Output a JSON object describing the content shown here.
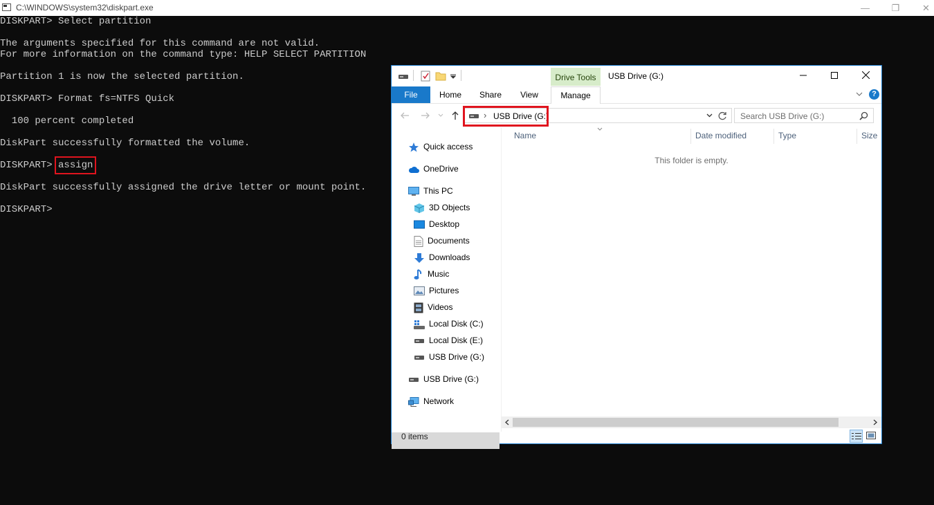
{
  "console": {
    "title": "C:\\WINDOWS\\system32\\diskpart.exe",
    "lines": [
      "DISKPART> Select partition",
      "",
      "The arguments specified for this command are not valid.",
      "For more information on the command type: HELP SELECT PARTITION",
      "",
      "Partition 1 is now the selected partition.",
      "",
      "DISKPART> Format fs=NTFS Quick",
      "",
      "  100 percent completed",
      "",
      "DiskPart successfully formatted the volume.",
      "",
      "",
      "",
      "DiskPart successfully assigned the drive letter or mount point.",
      "",
      "DISKPART>"
    ],
    "assign_prompt": "DISKPART> ",
    "assign_command": "assign",
    "buttons": {
      "minimize": "—",
      "restore": "❐",
      "close": "✕"
    }
  },
  "explorer": {
    "context_tab": "Drive Tools",
    "window_title": "USB Drive (G:)",
    "tabs": {
      "file": "File",
      "home": "Home",
      "share": "Share",
      "view": "View",
      "manage": "Manage"
    },
    "address": {
      "separator": "›",
      "location": "USB Drive (G:)"
    },
    "search_placeholder": "Search USB Drive (G:)",
    "columns": {
      "name": "Name",
      "date_modified": "Date modified",
      "type": "Type",
      "size": "Size"
    },
    "empty_message": "This folder is empty.",
    "nav": {
      "quick_access": "Quick access",
      "onedrive": "OneDrive",
      "this_pc": "This PC",
      "objects3d": "3D Objects",
      "desktop": "Desktop",
      "documents": "Documents",
      "downloads": "Downloads",
      "music": "Music",
      "pictures": "Pictures",
      "videos": "Videos",
      "local_c": "Local Disk (C:)",
      "local_e": "Local Disk (E:)",
      "usb_g_sub": "USB Drive (G:)",
      "usb_g": "USB Drive (G:)",
      "network": "Network"
    },
    "status_items": "0 items",
    "colors": {
      "accent": "#1979ca",
      "highlight": "#e0141e",
      "context_tab": "#d7ecca"
    }
  }
}
